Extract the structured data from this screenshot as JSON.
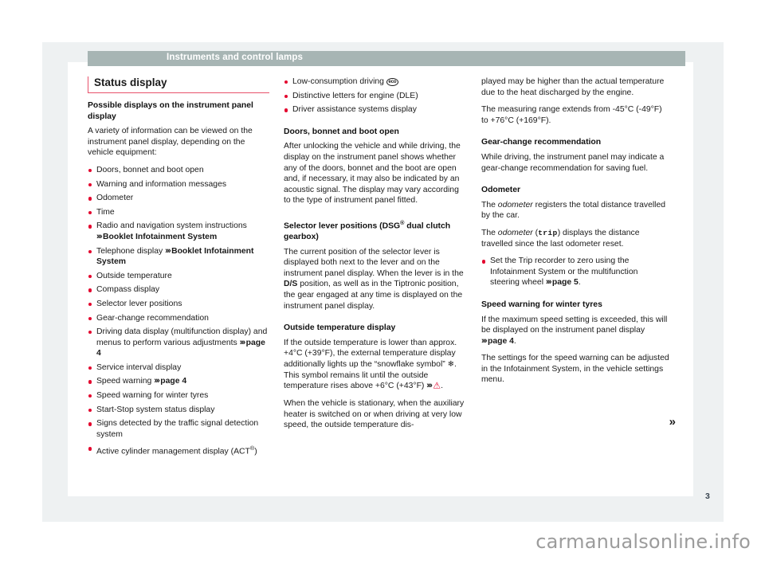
{
  "running_header": {
    "title": "Instruments and control lamps"
  },
  "folio": {
    "page_number": "3"
  },
  "watermark": {
    "text": "carmanualsonline.info"
  },
  "continuation": {
    "arrow": "»"
  },
  "section": {
    "title": "Status display"
  },
  "column_1": {
    "heading_1": "Possible displays on the instrument panel display",
    "intro": "A variety of information can be viewed on the instrument panel display, depending on the vehicle equipment:",
    "bullets": [
      {
        "text": "Doors, bonnet and boot open"
      },
      {
        "text": "Warning and information messages"
      },
      {
        "text": "Odometer"
      },
      {
        "text": "Time"
      },
      {
        "text": "Radio and navigation system instructions",
        "ref": "Booklet Infotainment System"
      },
      {
        "text": "Telephone display",
        "ref": "Booklet Infotainment System"
      },
      {
        "text": "Outside temperature"
      },
      {
        "text": "Compass display"
      },
      {
        "text": "Selector lever positions"
      },
      {
        "text": "Gear-change recommendation"
      },
      {
        "text": "Driving data display (multifunction display) and menus to perform various adjustments",
        "ref": "page 4"
      },
      {
        "text": "Service interval display"
      },
      {
        "text": "Speed warning",
        "ref": "page 4"
      },
      {
        "text": "Speed warning for winter tyres"
      },
      {
        "text": "Start-Stop system status display"
      },
      {
        "text": "Signs detected by the traffic signal detection system"
      },
      {
        "text": "Active cylinder management display (ACT",
        "sup": "®",
        "tail": ")"
      }
    ]
  },
  "column_2": {
    "bullets": [
      {
        "text": "Low-consumption driving",
        "icon": "eco-badge-icon",
        "icon_label": "eco"
      },
      {
        "text": "Distinctive letters for engine (DLE)"
      },
      {
        "text": "Driver assistance systems display"
      }
    ],
    "heading_doors": "Doors, bonnet and boot open",
    "para_doors": "After unlocking the vehicle and while driving, the display on the instrument panel shows whether any of the doors, bonnet and the boot are open and, if necessary, it may also be indicated by an acoustic signal. The display may vary according to the type of instrument panel fitted.",
    "heading_selector_a": "Selector lever positions (DSG",
    "heading_selector_sup": "®",
    "heading_selector_b": " dual clutch gearbox)",
    "para_selector_1": "The current position of the selector lever is displayed both next to the lever and on the instrument panel display. When the lever is in the ",
    "para_selector_ds": "D/S",
    "para_selector_2": " position, as well as in the Tiptronic position, the gear engaged at any time is displayed on the instrument panel display.",
    "heading_outside_temp": "Outside temperature display",
    "para_temp_1": "If the outside temperature is lower than approx. +4°C (+39°F), the external temperature display additionally lights up the “snowflake symbol” ",
    "para_temp_snowflake": "❄",
    "para_temp_2": ". This symbol remains lit until the outside temperature rises above +6°C (+43°F) ",
    "para_temp_warn": "⚠",
    "para_temp_3": ".",
    "para_temp_4": "When the vehicle is stationary, when the auxiliary heater is switched on or when driving at very low speed, the outside temperature dis-"
  },
  "column_3": {
    "para_cont": "played may be higher than the actual temperature due to the heat discharged by the engine.",
    "para_range": "The measuring range extends from -45°C (-49°F) to +76°C (+169°F).",
    "heading_gear": "Gear-change recommendation",
    "para_gear": "While driving, the instrument panel may indicate a gear-change recommendation for saving fuel.",
    "heading_odometer": "Odometer",
    "para_odo_1a": "The ",
    "para_odo_1b": "odometer",
    "para_odo_1c": " registers the total distance travelled by the car.",
    "para_odo_2a": "The ",
    "para_odo_2b": "odometer",
    "para_odo_2c": " (",
    "para_odo_2d": "trip",
    "para_odo_2e": ") displays the distance travelled since the last odometer reset.",
    "bullet_trip": "Set the Trip recorder to zero using the Infotainment System or the multifunction steering wheel",
    "bullet_trip_ref": "page 5",
    "bullet_trip_tail": ".",
    "heading_speed_warning": "Speed warning for winter tyres",
    "para_speed_1": "If the maximum speed setting is exceeded, this will be displayed on the instrument panel display ",
    "para_speed_ref": "page 4",
    "para_speed_1b": ".",
    "para_speed_2": "The settings for the speed warning can be adjusted in the Infotainment System, in the vehicle settings menu."
  },
  "colors": {
    "accent_red": "#e3052e",
    "rule_red": "#e8516b",
    "header_bar": "#a7b5b4",
    "paper_grey": "#eef1f2"
  }
}
